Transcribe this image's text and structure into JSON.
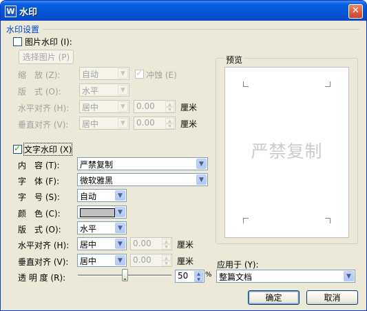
{
  "window": {
    "title": "水印",
    "app_icon": "W",
    "close_glyph": "✕"
  },
  "section_title": "水印设置",
  "picture_wm": {
    "label": "图片水印",
    "hotkey": "(I):",
    "checked": false,
    "select_button": "选择图片",
    "select_hotkey": "(P)",
    "scale_label": "缩　放",
    "scale_hotkey": "(Z):",
    "scale_value": "自动",
    "washout_label": "冲蚀",
    "washout_hotkey": "(E)",
    "washout_checked": true,
    "layout_label": "版　式",
    "layout_hotkey": "(O):",
    "layout_value": "水平",
    "halign_label": "水平对齐",
    "halign_hotkey": "(H):",
    "halign_value": "居中",
    "halign_offset": "0.00",
    "valign_label": "垂直对齐",
    "valign_hotkey": "(V):",
    "valign_value": "居中",
    "valign_offset": "0.00",
    "unit": "厘米"
  },
  "text_wm": {
    "label": "文字水印",
    "hotkey": "(X)",
    "checked": true,
    "content_label": "内　容",
    "content_hotkey": "(T):",
    "content_value": "严禁复制",
    "font_label": "字　体",
    "font_hotkey": "(F):",
    "font_value": "微软雅黑",
    "size_label": "字　号",
    "size_hotkey": "(S):",
    "size_value": "自动",
    "color_label": "颜　色",
    "color_hotkey": "(C):",
    "color_value": "#c0c0c0",
    "layout_label": "版　式",
    "layout_hotkey": "(O):",
    "layout_value": "水平",
    "halign_label": "水平对齐",
    "halign_hotkey": "(H):",
    "halign_value": "居中",
    "halign_offset": "0.00",
    "valign_label": "垂直对齐",
    "valign_hotkey": "(V):",
    "valign_value": "居中",
    "valign_offset": "0.00",
    "unit": "厘米",
    "transparency_label": "透 明 度",
    "transparency_hotkey": "(R):",
    "transparency_value": "50",
    "transparency_unit": "%",
    "transparency_fraction": 0.5
  },
  "preview": {
    "title": "预览",
    "watermark_text": "严禁复制"
  },
  "apply_to": {
    "label": "应用于",
    "hotkey": "(Y):",
    "value": "整篇文档"
  },
  "buttons": {
    "ok": "确定",
    "cancel": "取消"
  },
  "icons": {
    "dropdown": "▼",
    "spin_up": "▲",
    "spin_down": "▼"
  }
}
